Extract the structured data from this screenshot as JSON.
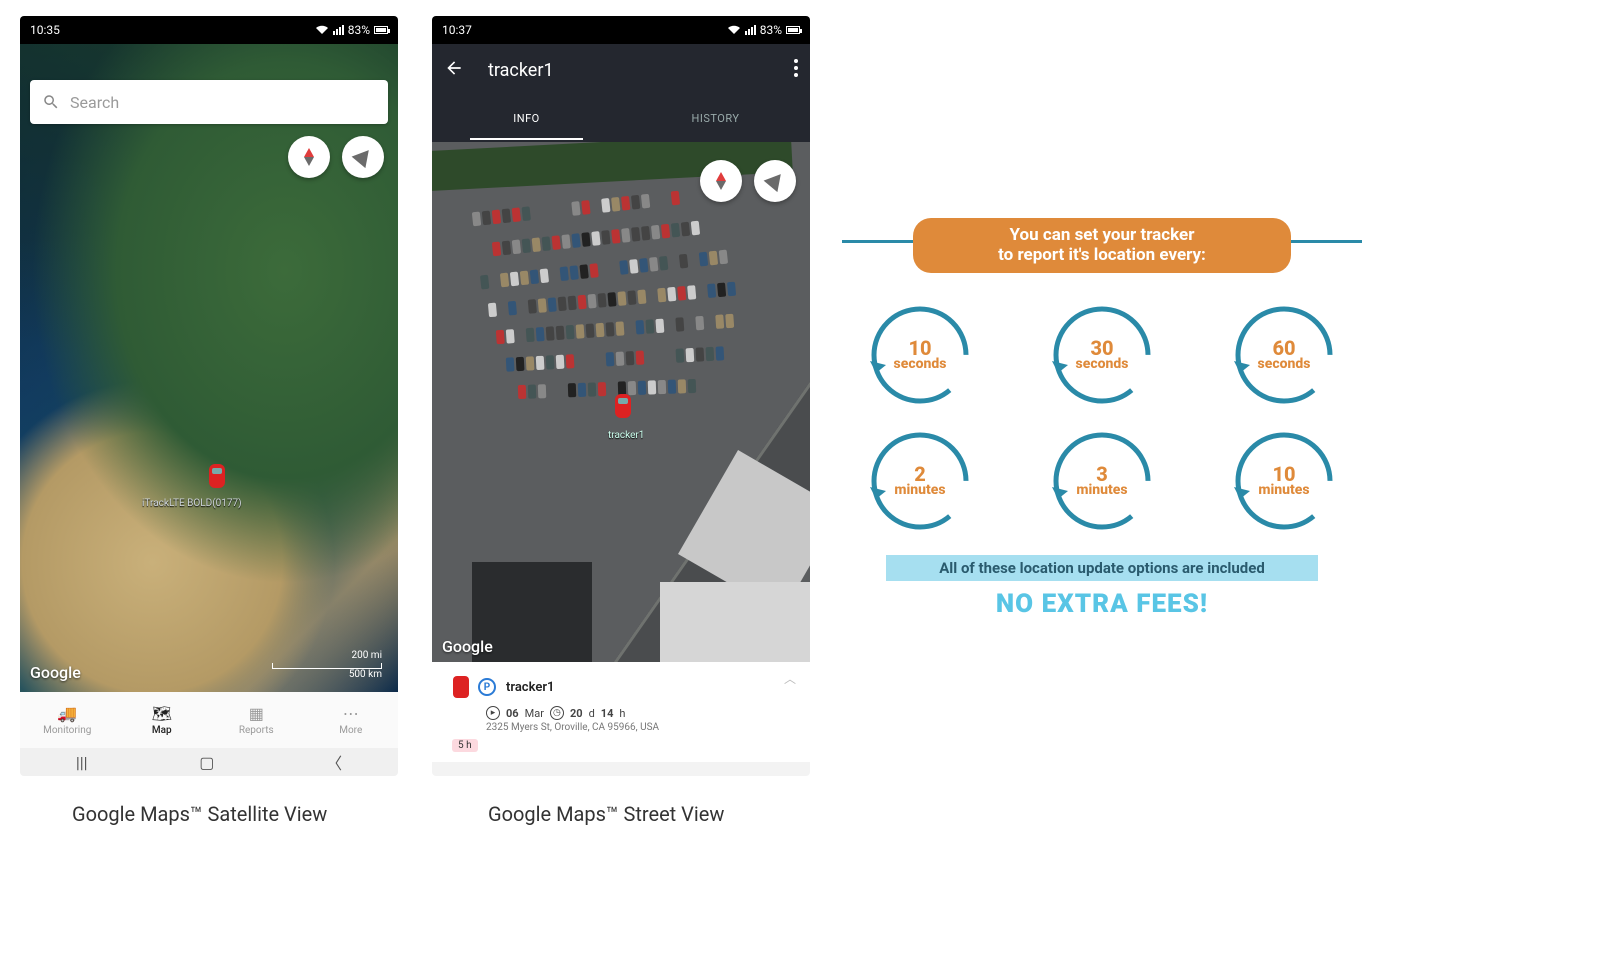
{
  "phone1": {
    "status": {
      "time": "10:35",
      "battery": "83%"
    },
    "search": {
      "placeholder": "Search"
    },
    "map": {
      "tracker_label": "iTrackLTE BOLD(0177)",
      "google_logo": "Google",
      "scale_mi": "200 mi",
      "scale_km": "500 km"
    },
    "tabs": {
      "monitoring": "Monitoring",
      "map": "Map",
      "reports": "Reports",
      "more": "More"
    },
    "caption": "Google Maps™ Satellite View"
  },
  "phone2": {
    "status": {
      "time": "10:37",
      "battery": "83%"
    },
    "header": {
      "title": "tracker1"
    },
    "tabs": {
      "info": "INFO",
      "history": "HISTORY"
    },
    "map": {
      "google_logo": "Google",
      "tracker_label": "tracker1"
    },
    "card": {
      "name": "tracker1",
      "parking_badge": "P",
      "date_value": "06",
      "date_unit": "Mar",
      "duration_d": "20",
      "duration_d_unit": "d",
      "duration_h": "14",
      "duration_h_unit": "h",
      "address": "2325 Myers St, Oroville, CA 95966, USA",
      "tag": "5 h"
    },
    "caption": "Google Maps™ Street View"
  },
  "info": {
    "headline1": "You can set your tracker",
    "headline2": "to report it's location every:",
    "options": [
      {
        "num": "10",
        "unit": "seconds"
      },
      {
        "num": "30",
        "unit": "seconds"
      },
      {
        "num": "60",
        "unit": "seconds"
      },
      {
        "num": "2",
        "unit": "minutes"
      },
      {
        "num": "3",
        "unit": "minutes"
      },
      {
        "num": "10",
        "unit": "minutes"
      }
    ],
    "subline": "All of these location update options are included",
    "noextra": "NO EXTRA FEES!"
  }
}
